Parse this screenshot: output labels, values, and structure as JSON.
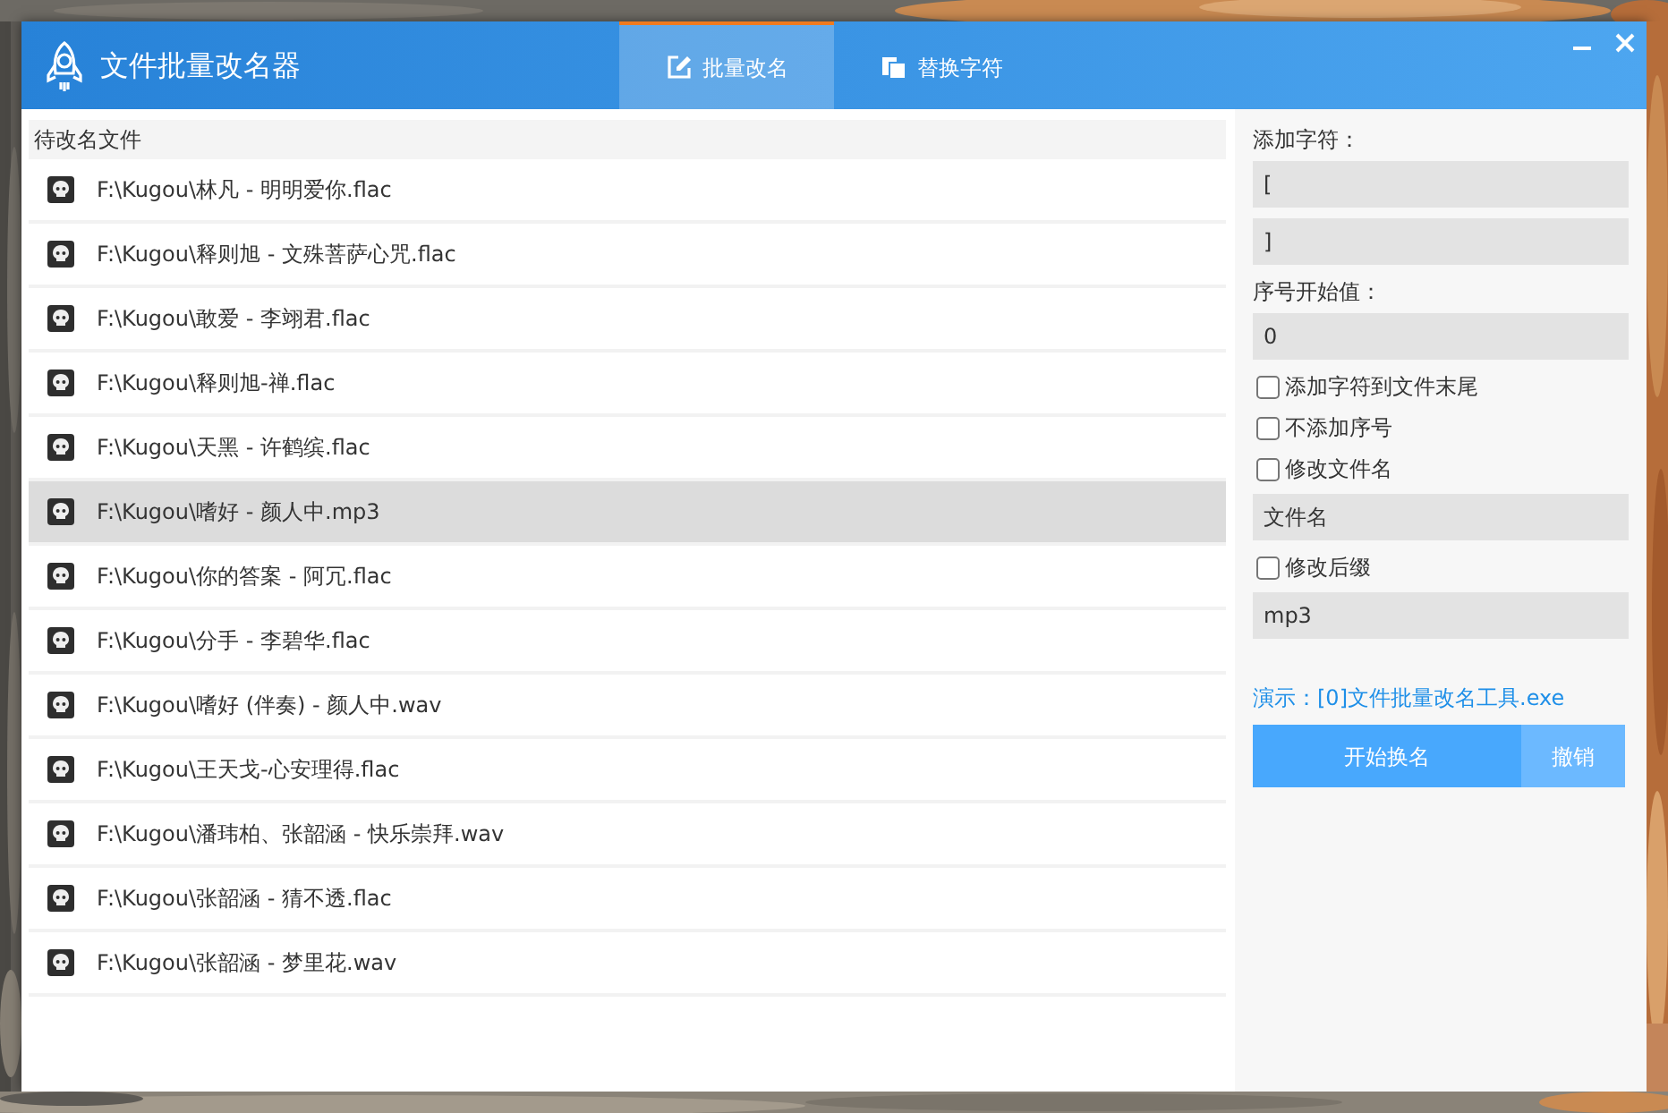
{
  "window": {
    "title": "文件批量改名器"
  },
  "tabs": [
    {
      "label": "批量改名",
      "selected": true
    },
    {
      "label": "替换字符",
      "selected": false
    }
  ],
  "file_list": {
    "header": "待改名文件",
    "rows": [
      {
        "path": "F:\\Kugou\\林凡 - 明明爱你.flac",
        "selected": false
      },
      {
        "path": "F:\\Kugou\\释则旭 - 文殊菩萨心咒.flac",
        "selected": false
      },
      {
        "path": "F:\\Kugou\\敢爱 - 李翊君.flac",
        "selected": false
      },
      {
        "path": "F:\\Kugou\\释则旭-禅.flac",
        "selected": false
      },
      {
        "path": "F:\\Kugou\\天黑 - 许鹤缤.flac",
        "selected": false
      },
      {
        "path": "F:\\Kugou\\嗜好 - 颜人中.mp3",
        "selected": true
      },
      {
        "path": "F:\\Kugou\\你的答案 - 阿冗.flac",
        "selected": false
      },
      {
        "path": "F:\\Kugou\\分手 - 李碧华.flac",
        "selected": false
      },
      {
        "path": "F:\\Kugou\\嗜好 (伴奏) - 颜人中.wav",
        "selected": false
      },
      {
        "path": "F:\\Kugou\\王天戈-心安理得.flac",
        "selected": false
      },
      {
        "path": "F:\\Kugou\\潘玮柏、张韶涵 - 快乐崇拜.wav",
        "selected": false
      },
      {
        "path": "F:\\Kugou\\张韶涵 - 猜不透.flac",
        "selected": false
      },
      {
        "path": "F:\\Kugou\\张韶涵 - 梦里花.wav",
        "selected": false
      }
    ]
  },
  "options": {
    "items": [
      {
        "kind": "label",
        "text": "添加字符："
      },
      {
        "kind": "field",
        "value": "["
      },
      {
        "kind": "field",
        "value": "]"
      },
      {
        "kind": "label",
        "text": "序号开始值："
      },
      {
        "kind": "field",
        "value": "0"
      },
      {
        "kind": "checkbox",
        "label": "添加字符到文件末尾",
        "checked": false
      },
      {
        "kind": "checkbox",
        "label": "不添加序号",
        "checked": false
      },
      {
        "kind": "checkbox",
        "label": "修改文件名",
        "checked": false
      },
      {
        "kind": "field",
        "value": "文件名"
      },
      {
        "kind": "checkbox",
        "label": "修改后缀",
        "checked": false
      },
      {
        "kind": "field",
        "value": "mp3"
      }
    ],
    "preview": "演示：[0]文件批量改名工具.exe",
    "buttons": [
      {
        "label": "开始换名",
        "kind": "primary"
      },
      {
        "label": "撤销",
        "kind": "secondary"
      }
    ]
  }
}
